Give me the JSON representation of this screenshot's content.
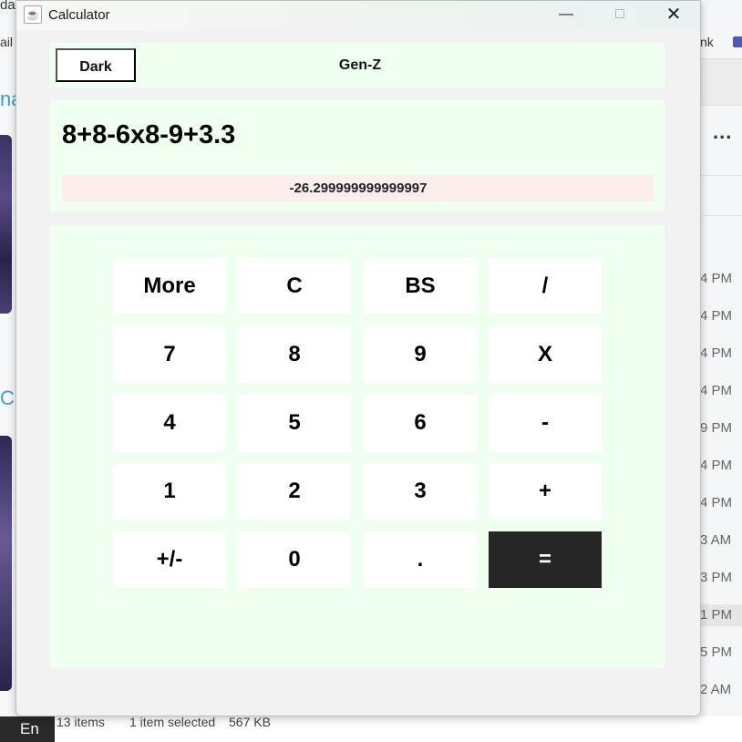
{
  "background": {
    "left_fragments": [
      "da",
      "ail",
      "na",
      "C"
    ],
    "right_fragments": {
      "ink": "nk",
      "more": "...",
      "times": [
        "4 PM",
        "4 PM",
        "4 PM",
        "4 PM",
        "9 PM",
        "4 PM",
        "4 PM",
        "3 AM",
        "3 PM",
        "1 PM",
        "5 PM",
        "2 AM"
      ]
    },
    "explorer_status": {
      "items": "13 items",
      "selected": "1 item selected",
      "size": "567 KB"
    },
    "taskbar_text": "En"
  },
  "window": {
    "title": "Calculator",
    "controls": {
      "minimize": "—",
      "maximize": "□",
      "close": "✕"
    }
  },
  "toolbar": {
    "theme_button": "Dark",
    "mode_label": "Gen-Z"
  },
  "display": {
    "expression": "8+8-6x8-9+3.3",
    "result": "-26.299999999999997"
  },
  "keypad": {
    "rows": [
      [
        "More",
        "C",
        "BS",
        "/"
      ],
      [
        "7",
        "8",
        "9",
        "X"
      ],
      [
        "4",
        "5",
        "6",
        "-"
      ],
      [
        "1",
        "2",
        "3",
        "+"
      ],
      [
        "+/-",
        "0",
        ".",
        "="
      ]
    ]
  },
  "colors": {
    "panel_bg": "#effff0",
    "result_bg": "#fdeeee",
    "equals_bg": "#262626",
    "key_bg": "#ffffff"
  }
}
